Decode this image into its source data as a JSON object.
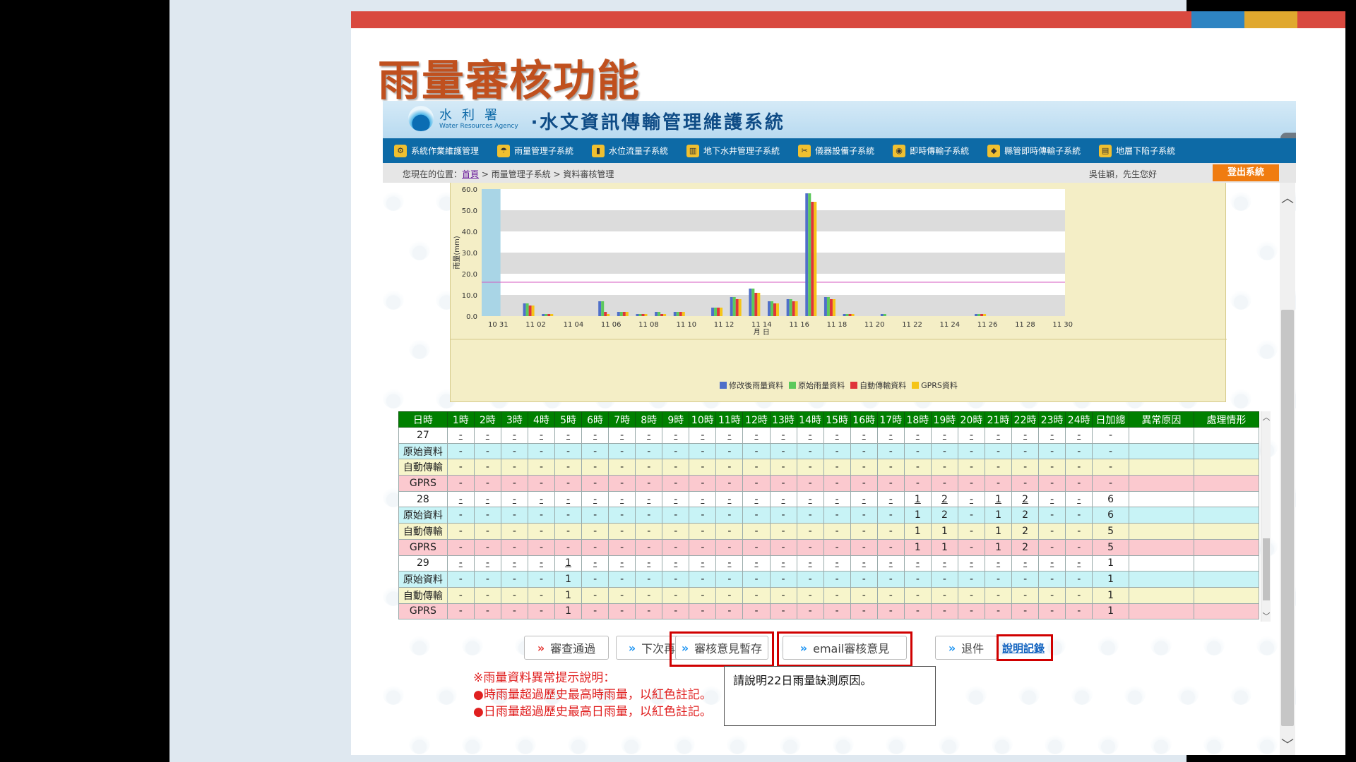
{
  "slide": {
    "title": "雨量審核功能",
    "bar_colors": [
      "#d9493f",
      "#2e84c2",
      "#e0a82e",
      "#d9493f"
    ]
  },
  "header": {
    "agency_cn": "水利署",
    "agency_en": "Water Resources Agency",
    "system_title": "‧水文資訊傳輸管理維護系統"
  },
  "nav": {
    "items": [
      {
        "label": "系統作業維護管理",
        "icon": "gear-icon"
      },
      {
        "label": "雨量管理子系統",
        "icon": "rain-icon"
      },
      {
        "label": "水位流量子系統",
        "icon": "gauge-icon"
      },
      {
        "label": "地下水井管理子系統",
        "icon": "well-icon"
      },
      {
        "label": "儀器設備子系統",
        "icon": "tools-icon"
      },
      {
        "label": "即時傳輸子系統",
        "icon": "transmit-icon"
      },
      {
        "label": "縣管即時傳輸子系統",
        "icon": "county-icon"
      },
      {
        "label": "地層下陷子系統",
        "icon": "subsidence-icon"
      }
    ]
  },
  "breadcrumb": {
    "prefix": "您現在的位置：",
    "home": "首頁",
    "rest": " > 雨量管理子系統 > 資料審核管理"
  },
  "user": {
    "greeting": "吳佳穎，先生您好",
    "logout_label": "登出系統"
  },
  "chart_data": {
    "type": "bar",
    "ylabel": "雨量(mm)",
    "xlabel": "月 日",
    "ylim": [
      0,
      60
    ],
    "yticks": [
      "0.0",
      "10.0",
      "20.0",
      "30.0",
      "40.0",
      "50.0",
      "60.0"
    ],
    "threshold": 16,
    "categories": [
      "10 31",
      "11 01",
      "11 02",
      "11 03",
      "11 04",
      "11 05",
      "11 06",
      "11 07",
      "11 08",
      "11 09",
      "11 10",
      "11 11",
      "11 12",
      "11 13",
      "11 14",
      "11 15",
      "11 16",
      "11 17",
      "11 18",
      "11 19",
      "11 20",
      "11 21",
      "11 22",
      "11 23",
      "11 24",
      "11 25",
      "11 26",
      "11 27",
      "11 28",
      "11 29",
      "11 30"
    ],
    "xtick_labels": [
      "10 31",
      "11 02",
      "11 04",
      "11 06",
      "11 08",
      "11 10",
      "11 12",
      "11 14",
      "11 16",
      "11 18",
      "11 20",
      "11 22",
      "11 24",
      "11 26",
      "11 28",
      "11 30"
    ],
    "series": [
      {
        "name": "修改後雨量資料",
        "color": "#4f6fc9",
        "values": [
          0,
          0,
          6,
          1,
          0,
          0,
          7,
          2,
          1,
          2,
          2,
          0,
          4,
          9,
          13,
          7,
          8,
          58,
          9,
          1,
          0,
          1,
          0,
          0,
          0,
          0,
          1,
          0,
          0,
          0,
          0
        ]
      },
      {
        "name": "原始雨量資料",
        "color": "#5cc95c",
        "values": [
          0,
          0,
          6,
          1,
          0,
          0,
          7,
          2,
          1,
          2,
          2,
          0,
          4,
          9,
          13,
          7,
          8,
          58,
          9,
          1,
          0,
          1,
          0,
          0,
          0,
          0,
          1,
          0,
          0,
          0,
          0
        ]
      },
      {
        "name": "自動傳輸資料",
        "color": "#e0343a",
        "values": [
          0,
          0,
          5,
          1,
          0,
          0,
          2,
          2,
          1,
          1,
          2,
          0,
          4,
          8,
          11,
          6,
          7,
          54,
          8,
          1,
          0,
          0,
          0,
          0,
          0,
          0,
          1,
          0,
          0,
          0,
          0
        ]
      },
      {
        "name": "GPRS資料",
        "color": "#f5c518",
        "values": [
          0,
          0,
          5,
          1,
          0,
          0,
          1,
          2,
          1,
          1,
          2,
          0,
          4,
          8,
          11,
          6,
          7,
          54,
          8,
          1,
          0,
          0,
          0,
          0,
          0,
          0,
          1,
          0,
          0,
          0,
          0
        ]
      }
    ]
  },
  "table": {
    "headers": [
      "日時",
      "1時",
      "2時",
      "3時",
      "4時",
      "5時",
      "6時",
      "7時",
      "8時",
      "9時",
      "10時",
      "11時",
      "12時",
      "13時",
      "14時",
      "15時",
      "16時",
      "17時",
      "18時",
      "19時",
      "20時",
      "21時",
      "22時",
      "23時",
      "24時",
      "日加總",
      "異常原因",
      "處理情形"
    ],
    "rows": [
      {
        "type": "day",
        "label": "27",
        "values": [
          "-",
          "-",
          "-",
          "-",
          "-",
          "-",
          "-",
          "-",
          "-",
          "-",
          "-",
          "-",
          "-",
          "-",
          "-",
          "-",
          "-",
          "-",
          "-",
          "-",
          "-",
          "-",
          "-",
          "-",
          "-"
        ]
      },
      {
        "type": "orig",
        "label": "原始資料",
        "values": [
          "-",
          "-",
          "-",
          "-",
          "-",
          "-",
          "-",
          "-",
          "-",
          "-",
          "-",
          "-",
          "-",
          "-",
          "-",
          "-",
          "-",
          "-",
          "-",
          "-",
          "-",
          "-",
          "-",
          "-",
          "-"
        ]
      },
      {
        "type": "auto",
        "label": "自動傳輸",
        "values": [
          "-",
          "-",
          "-",
          "-",
          "-",
          "-",
          "-",
          "-",
          "-",
          "-",
          "-",
          "-",
          "-",
          "-",
          "-",
          "-",
          "-",
          "-",
          "-",
          "-",
          "-",
          "-",
          "-",
          "-",
          "-"
        ]
      },
      {
        "type": "gprs",
        "label": "GPRS",
        "values": [
          "-",
          "-",
          "-",
          "-",
          "-",
          "-",
          "-",
          "-",
          "-",
          "-",
          "-",
          "-",
          "-",
          "-",
          "-",
          "-",
          "-",
          "-",
          "-",
          "-",
          "-",
          "-",
          "-",
          "-",
          "-"
        ]
      },
      {
        "type": "day",
        "label": "28",
        "values": [
          "-",
          "-",
          "-",
          "-",
          "-",
          "-",
          "-",
          "-",
          "-",
          "-",
          "-",
          "-",
          "-",
          "-",
          "-",
          "-",
          "-",
          "1",
          "2",
          "-",
          "1",
          "2",
          "-",
          "-",
          "6"
        ]
      },
      {
        "type": "orig",
        "label": "原始資料",
        "values": [
          "-",
          "-",
          "-",
          "-",
          "-",
          "-",
          "-",
          "-",
          "-",
          "-",
          "-",
          "-",
          "-",
          "-",
          "-",
          "-",
          "-",
          "1",
          "2",
          "-",
          "1",
          "2",
          "-",
          "-",
          "6"
        ]
      },
      {
        "type": "auto",
        "label": "自動傳輸",
        "values": [
          "-",
          "-",
          "-",
          "-",
          "-",
          "-",
          "-",
          "-",
          "-",
          "-",
          "-",
          "-",
          "-",
          "-",
          "-",
          "-",
          "-",
          "1",
          "1",
          "-",
          "1",
          "2",
          "-",
          "-",
          "5"
        ]
      },
      {
        "type": "gprs",
        "label": "GPRS",
        "values": [
          "-",
          "-",
          "-",
          "-",
          "-",
          "-",
          "-",
          "-",
          "-",
          "-",
          "-",
          "-",
          "-",
          "-",
          "-",
          "-",
          "-",
          "1",
          "1",
          "-",
          "1",
          "2",
          "-",
          "-",
          "5"
        ]
      },
      {
        "type": "day",
        "label": "29",
        "values": [
          "-",
          "-",
          "-",
          "-",
          "1",
          "-",
          "-",
          "-",
          "-",
          "-",
          "-",
          "-",
          "-",
          "-",
          "-",
          "-",
          "-",
          "-",
          "-",
          "-",
          "-",
          "-",
          "-",
          "-",
          "1"
        ]
      },
      {
        "type": "orig",
        "label": "原始資料",
        "values": [
          "-",
          "-",
          "-",
          "-",
          "1",
          "-",
          "-",
          "-",
          "-",
          "-",
          "-",
          "-",
          "-",
          "-",
          "-",
          "-",
          "-",
          "-",
          "-",
          "-",
          "-",
          "-",
          "-",
          "-",
          "1"
        ]
      },
      {
        "type": "auto",
        "label": "自動傳輸",
        "values": [
          "-",
          "-",
          "-",
          "-",
          "1",
          "-",
          "-",
          "-",
          "-",
          "-",
          "-",
          "-",
          "-",
          "-",
          "-",
          "-",
          "-",
          "-",
          "-",
          "-",
          "-",
          "-",
          "-",
          "-",
          "1"
        ]
      },
      {
        "type": "gprs",
        "label": "GPRS",
        "values": [
          "-",
          "-",
          "-",
          "-",
          "1",
          "-",
          "-",
          "-",
          "-",
          "-",
          "-",
          "-",
          "-",
          "-",
          "-",
          "-",
          "-",
          "-",
          "-",
          "-",
          "-",
          "-",
          "-",
          "-",
          "1"
        ]
      }
    ]
  },
  "actions": {
    "approve": "審查通過",
    "next_review": "下次再審",
    "save_opinion": "審核意見暫存",
    "email_opinion": "email審核意見",
    "return": "退件",
    "explain_log": "說明記錄"
  },
  "notes": {
    "title": "※雨量資料異常提示說明：",
    "line1": "●時雨量超過歷史最高時雨量，以紅色註記。",
    "line2": "●日雨量超過歷史最高日雨量，以紅色註記。"
  },
  "comment": {
    "value": "請說明22日雨量缺測原因。"
  }
}
